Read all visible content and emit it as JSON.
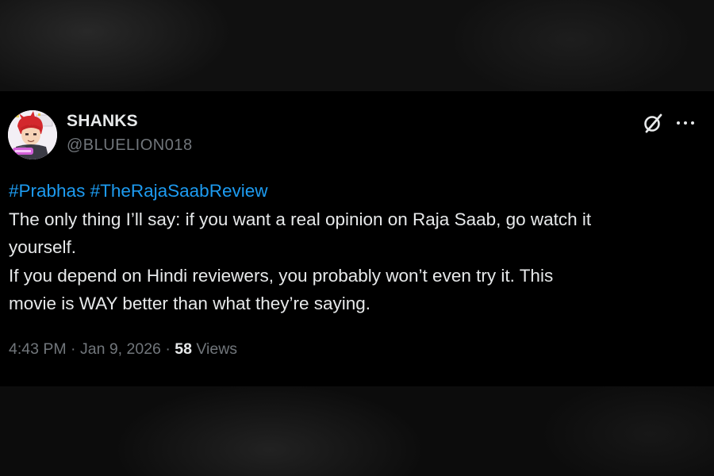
{
  "tweet": {
    "author": {
      "display_name": "SHANKS",
      "handle": "@BLUELION018",
      "avatar_icon": "anime-character-avatar"
    },
    "actions": {
      "grok_icon": "grok-slash-icon",
      "more_icon": "more-dots-icon"
    },
    "hashtags": [
      "#Prabhas",
      "#TheRajaSaabReview"
    ],
    "text_lines": [
      "The only thing I’ll say: if you want a real opinion on Raja Saab, go watch it",
      "yourself.",
      "If you depend on Hindi reviewers, you probably won’t even try it. This",
      "movie is WAY better than what they’re saying."
    ],
    "meta": {
      "time": "4:43 PM",
      "separator": "·",
      "date": "Jan 9, 2026",
      "views_count": "58",
      "views_label": "Views"
    }
  },
  "colors": {
    "text": "#e7e9ea",
    "secondary_text": "#71767b",
    "hashtag": "#1d9bf0",
    "card_background": "#000000"
  }
}
